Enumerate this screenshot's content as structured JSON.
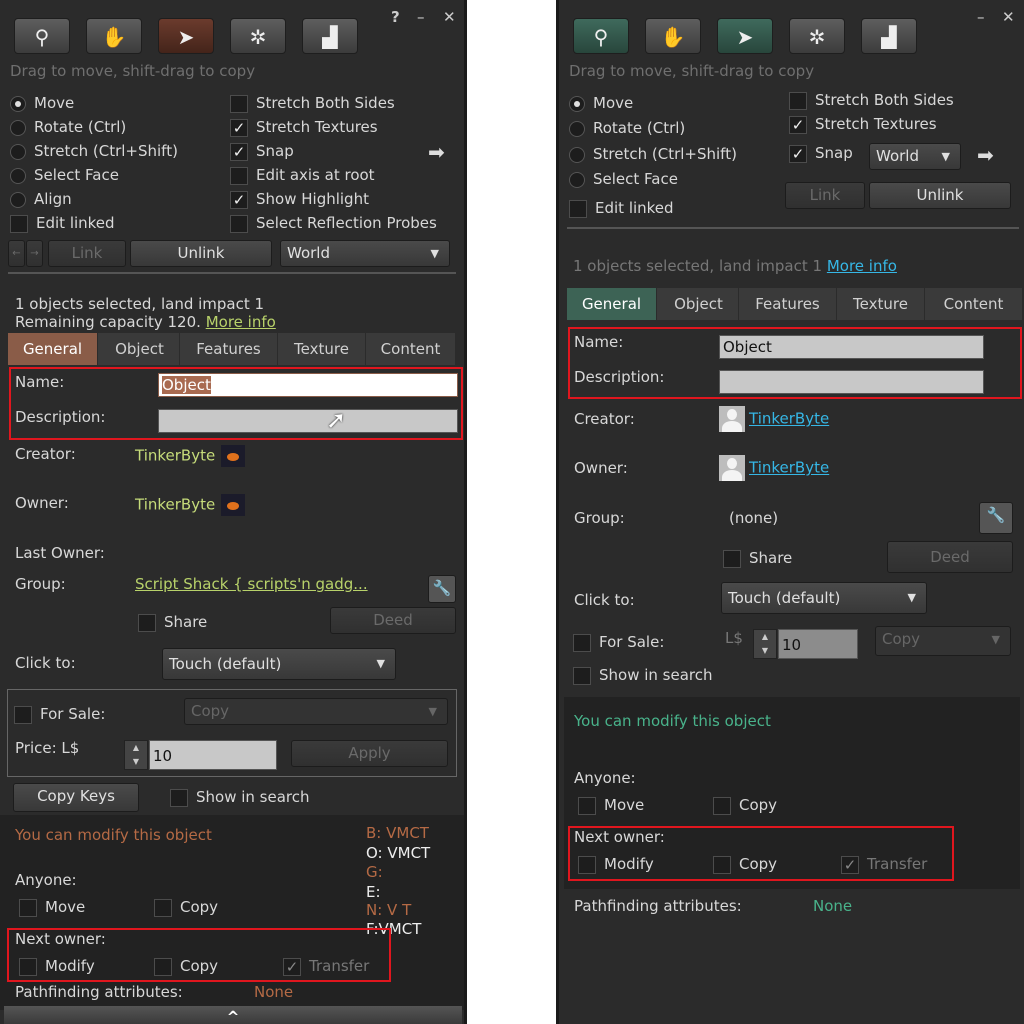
{
  "toolbar": {
    "tools": [
      "zoom-tool",
      "grab-tool",
      "select-tool",
      "create-tool",
      "land-tool"
    ],
    "help": "?",
    "minimize": "–",
    "close": "✕",
    "hint": "Drag to move, shift-drag to copy"
  },
  "left": {
    "radios": [
      "Move",
      "Rotate (Ctrl)",
      "Stretch (Ctrl+Shift)",
      "Select Face",
      "Align"
    ],
    "edit_linked": "Edit linked",
    "checks": [
      "Stretch Both Sides",
      "Stretch Textures",
      "Snap",
      "Edit axis at root",
      "Show Highlight",
      "Select Reflection Probes"
    ],
    "link": "Link",
    "unlink": "Unlink",
    "world": "World",
    "selected_line1": "1 objects selected, land impact 1",
    "selected_line2": "Remaining capacity 120.",
    "more_info": "More info",
    "tabs": [
      "General",
      "Object",
      "Features",
      "Texture",
      "Content"
    ],
    "name_label": "Name:",
    "name_value": "Object",
    "description_label": "Description:",
    "creator_label": "Creator:",
    "creator": "TinkerByte",
    "owner_label": "Owner:",
    "owner": "TinkerByte",
    "last_owner_label": "Last Owner:",
    "group_label": "Group:",
    "group": "Script Shack { scripts'n gadg...",
    "share": "Share",
    "deed": "Deed",
    "click_to_label": "Click to:",
    "click_to": "Touch  (default)",
    "for_sale": "For Sale:",
    "copy_dd": "Copy",
    "price_label": "Price: L$",
    "price": "10",
    "apply": "Apply",
    "copy_keys": "Copy Keys",
    "show_in_search": "Show in search",
    "modify_msg": "You can modify this object",
    "perm_b": "B: VMCT",
    "perm_o": "O: VMCT",
    "perm_g": "G:",
    "perm_e": "E:",
    "perm_n": "N: V  T",
    "perm_f": "F:VMCT",
    "anyone": "Anyone:",
    "move": "Move",
    "copy": "Copy",
    "next_owner": "Next owner:",
    "modify": "Modify",
    "transfer": "Transfer",
    "pathfinding_label": "Pathfinding attributes:",
    "pathfinding": "None",
    "expand": "^"
  },
  "right": {
    "radios": [
      "Move",
      "Rotate (Ctrl)",
      "Stretch (Ctrl+Shift)",
      "Select Face"
    ],
    "edit_linked": "Edit linked",
    "checks": [
      "Stretch Both Sides",
      "Stretch Textures",
      "Snap"
    ],
    "world": "World",
    "link": "Link",
    "unlink": "Unlink",
    "selected": "1 objects selected, land impact 1",
    "more_info": "More info",
    "tabs": [
      "General",
      "Object",
      "Features",
      "Texture",
      "Content"
    ],
    "name_label": "Name:",
    "name_value": "Object",
    "description_label": "Description:",
    "creator_label": "Creator:",
    "creator": "TinkerByte",
    "owner_label": "Owner:",
    "owner": "TinkerByte",
    "group_label": "Group:",
    "group": "(none)",
    "share": "Share",
    "deed": "Deed",
    "click_to_label": "Click to:",
    "click_to": "Touch  (default)",
    "for_sale": "For Sale:",
    "currency": "L$",
    "price": "10",
    "copy_dd": "Copy",
    "show_in_search": "Show in search",
    "modify_msg": "You can modify this object",
    "anyone": "Anyone:",
    "move": "Move",
    "copy": "Copy",
    "next_owner": "Next owner:",
    "modify": "Modify",
    "transfer": "Transfer",
    "pathfinding_label": "Pathfinding attributes:",
    "pathfinding": "None"
  },
  "colors": {
    "highlight_box": "#e0161e",
    "link_left": "#b8d26a",
    "link_right": "#36b7e6",
    "tab_left_active": "#8a5c48",
    "tab_right_active": "#3d6355"
  }
}
